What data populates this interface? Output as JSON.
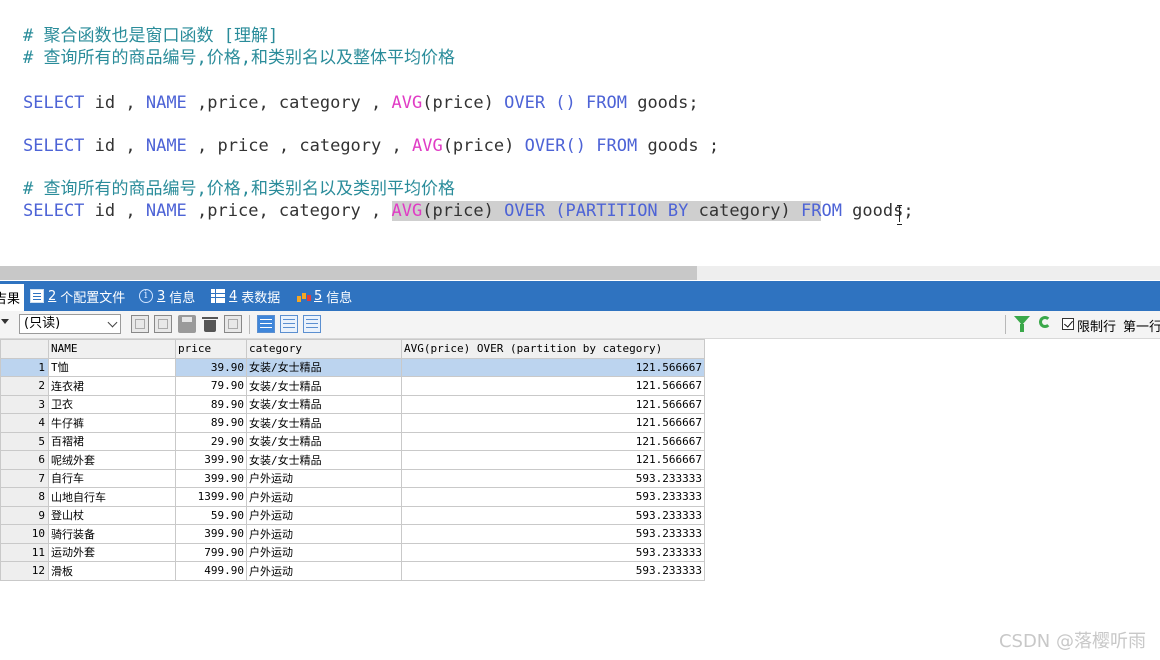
{
  "editor": {
    "line1_comment": "# 聚合函数也是窗口函数 [理解]",
    "line2_comment": "# 查询所有的商品编号,价格,和类别名以及整体平均价格",
    "sql1": {
      "p1_kw": "SELECT",
      "p2": " id , ",
      "p3_kw": "NAME",
      "p4": " ,price, category , ",
      "p5_fn": "AVG",
      "p6": "(price) ",
      "p7_kw": "OVER",
      "p8": " () ",
      "p9_kw": "FROM",
      "p10": " goods;"
    },
    "sql2": {
      "p1_kw": "SELECT",
      "p2": " id , ",
      "p3_kw": "NAME",
      "p4": " , price , category , ",
      "p5_fn": "AVG",
      "p6": "(price) ",
      "p7_kw": "OVER",
      "p8": "() ",
      "p9_kw": "FROM",
      "p10": " goods ;"
    },
    "line5_comment": "# 查询所有的商品编号,价格,和类别名以及类别平均价格",
    "sql3": {
      "p1_kw": "SELECT",
      "p2": " id , ",
      "p3_kw": "NAME",
      "p4": " ,price, category , ",
      "p5_fn": "AVG",
      "p6": "(price) ",
      "p7_kw": "OVER",
      "p8": " (",
      "p9_kw": "PARTITION BY",
      "p10": " category) ",
      "p11_kw_sel": "FR",
      "p12_kw": "OM",
      "p13": " goods;"
    }
  },
  "tabs": [
    {
      "label": "吉果",
      "active": true
    },
    {
      "num": "2",
      "label": "个配置文件"
    },
    {
      "num": "3",
      "label": "信息"
    },
    {
      "num": "4",
      "label": "表数据"
    },
    {
      "num": "5",
      "label": "信息"
    }
  ],
  "toolbar": {
    "mode_select": "(只读)",
    "limit_rows_label": "限制行",
    "first_row_label": "第一行"
  },
  "result": {
    "columns": [
      "NAME",
      "price",
      "category",
      "AVG(price) OVER (partition by category)"
    ],
    "rows": [
      [
        "1",
        "T恤",
        "39.90",
        "女装/女士精品",
        "121.566667"
      ],
      [
        "2",
        "连衣裙",
        "79.90",
        "女装/女士精品",
        "121.566667"
      ],
      [
        "3",
        "卫衣",
        "89.90",
        "女装/女士精品",
        "121.566667"
      ],
      [
        "4",
        "牛仔裤",
        "89.90",
        "女装/女士精品",
        "121.566667"
      ],
      [
        "5",
        "百褶裙",
        "29.90",
        "女装/女士精品",
        "121.566667"
      ],
      [
        "6",
        "呢绒外套",
        "399.90",
        "女装/女士精品",
        "121.566667"
      ],
      [
        "7",
        "自行车",
        "399.90",
        "户外运动",
        "593.233333"
      ],
      [
        "8",
        "山地自行车",
        "1399.90",
        "户外运动",
        "593.233333"
      ],
      [
        "9",
        "登山杖",
        "59.90",
        "户外运动",
        "593.233333"
      ],
      [
        "10",
        "骑行装备",
        "399.90",
        "户外运动",
        "593.233333"
      ],
      [
        "11",
        "运动外套",
        "799.90",
        "户外运动",
        "593.233333"
      ],
      [
        "12",
        "滑板",
        "499.90",
        "户外运动",
        "593.233333"
      ]
    ]
  },
  "watermark": "CSDN @落樱听雨"
}
